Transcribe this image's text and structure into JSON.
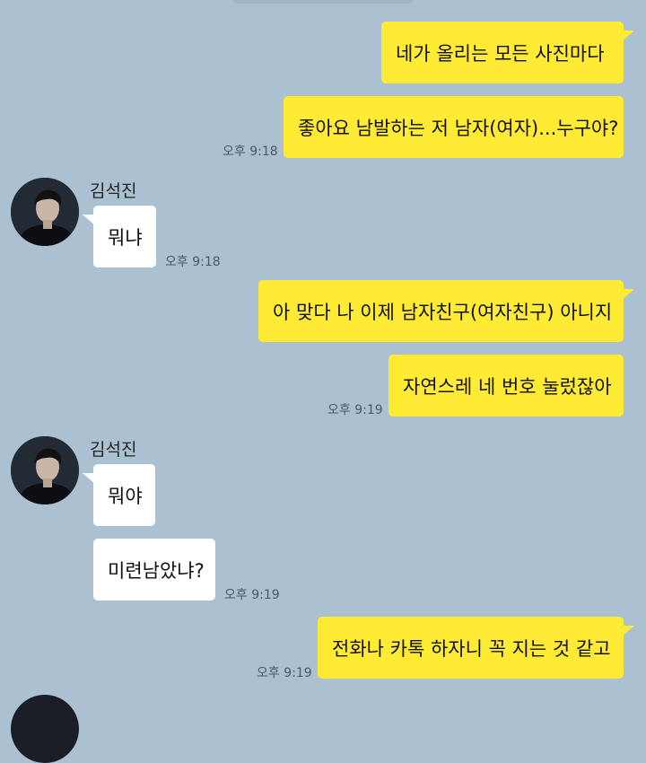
{
  "contact": {
    "name": "김석진"
  },
  "colors": {
    "background": "#abc1d1",
    "my_bubble": "#ffeb33",
    "their_bubble": "#ffffff"
  },
  "messages": {
    "m1": {
      "text": "네가 올리는 모든 사진마다"
    },
    "m2": {
      "text": "좋아요 남발하는 저 남자(여자)...누구야?",
      "time": "오후 9:18"
    },
    "m3": {
      "text": "뭐냐",
      "time": "오후 9:18"
    },
    "m4": {
      "text": "아 맞다 나 이제 남자친구(여자친구) 아니지"
    },
    "m5": {
      "text": "자연스레 네 번호 눌렀잖아",
      "time": "오후 9:19"
    },
    "m6": {
      "text": "뭐야"
    },
    "m7": {
      "text": "미련남았냐?",
      "time": "오후 9:19"
    },
    "m8": {
      "text": "전화나 카톡 하자니 꼭 지는 것 같고",
      "time": "오후 9:19"
    }
  }
}
